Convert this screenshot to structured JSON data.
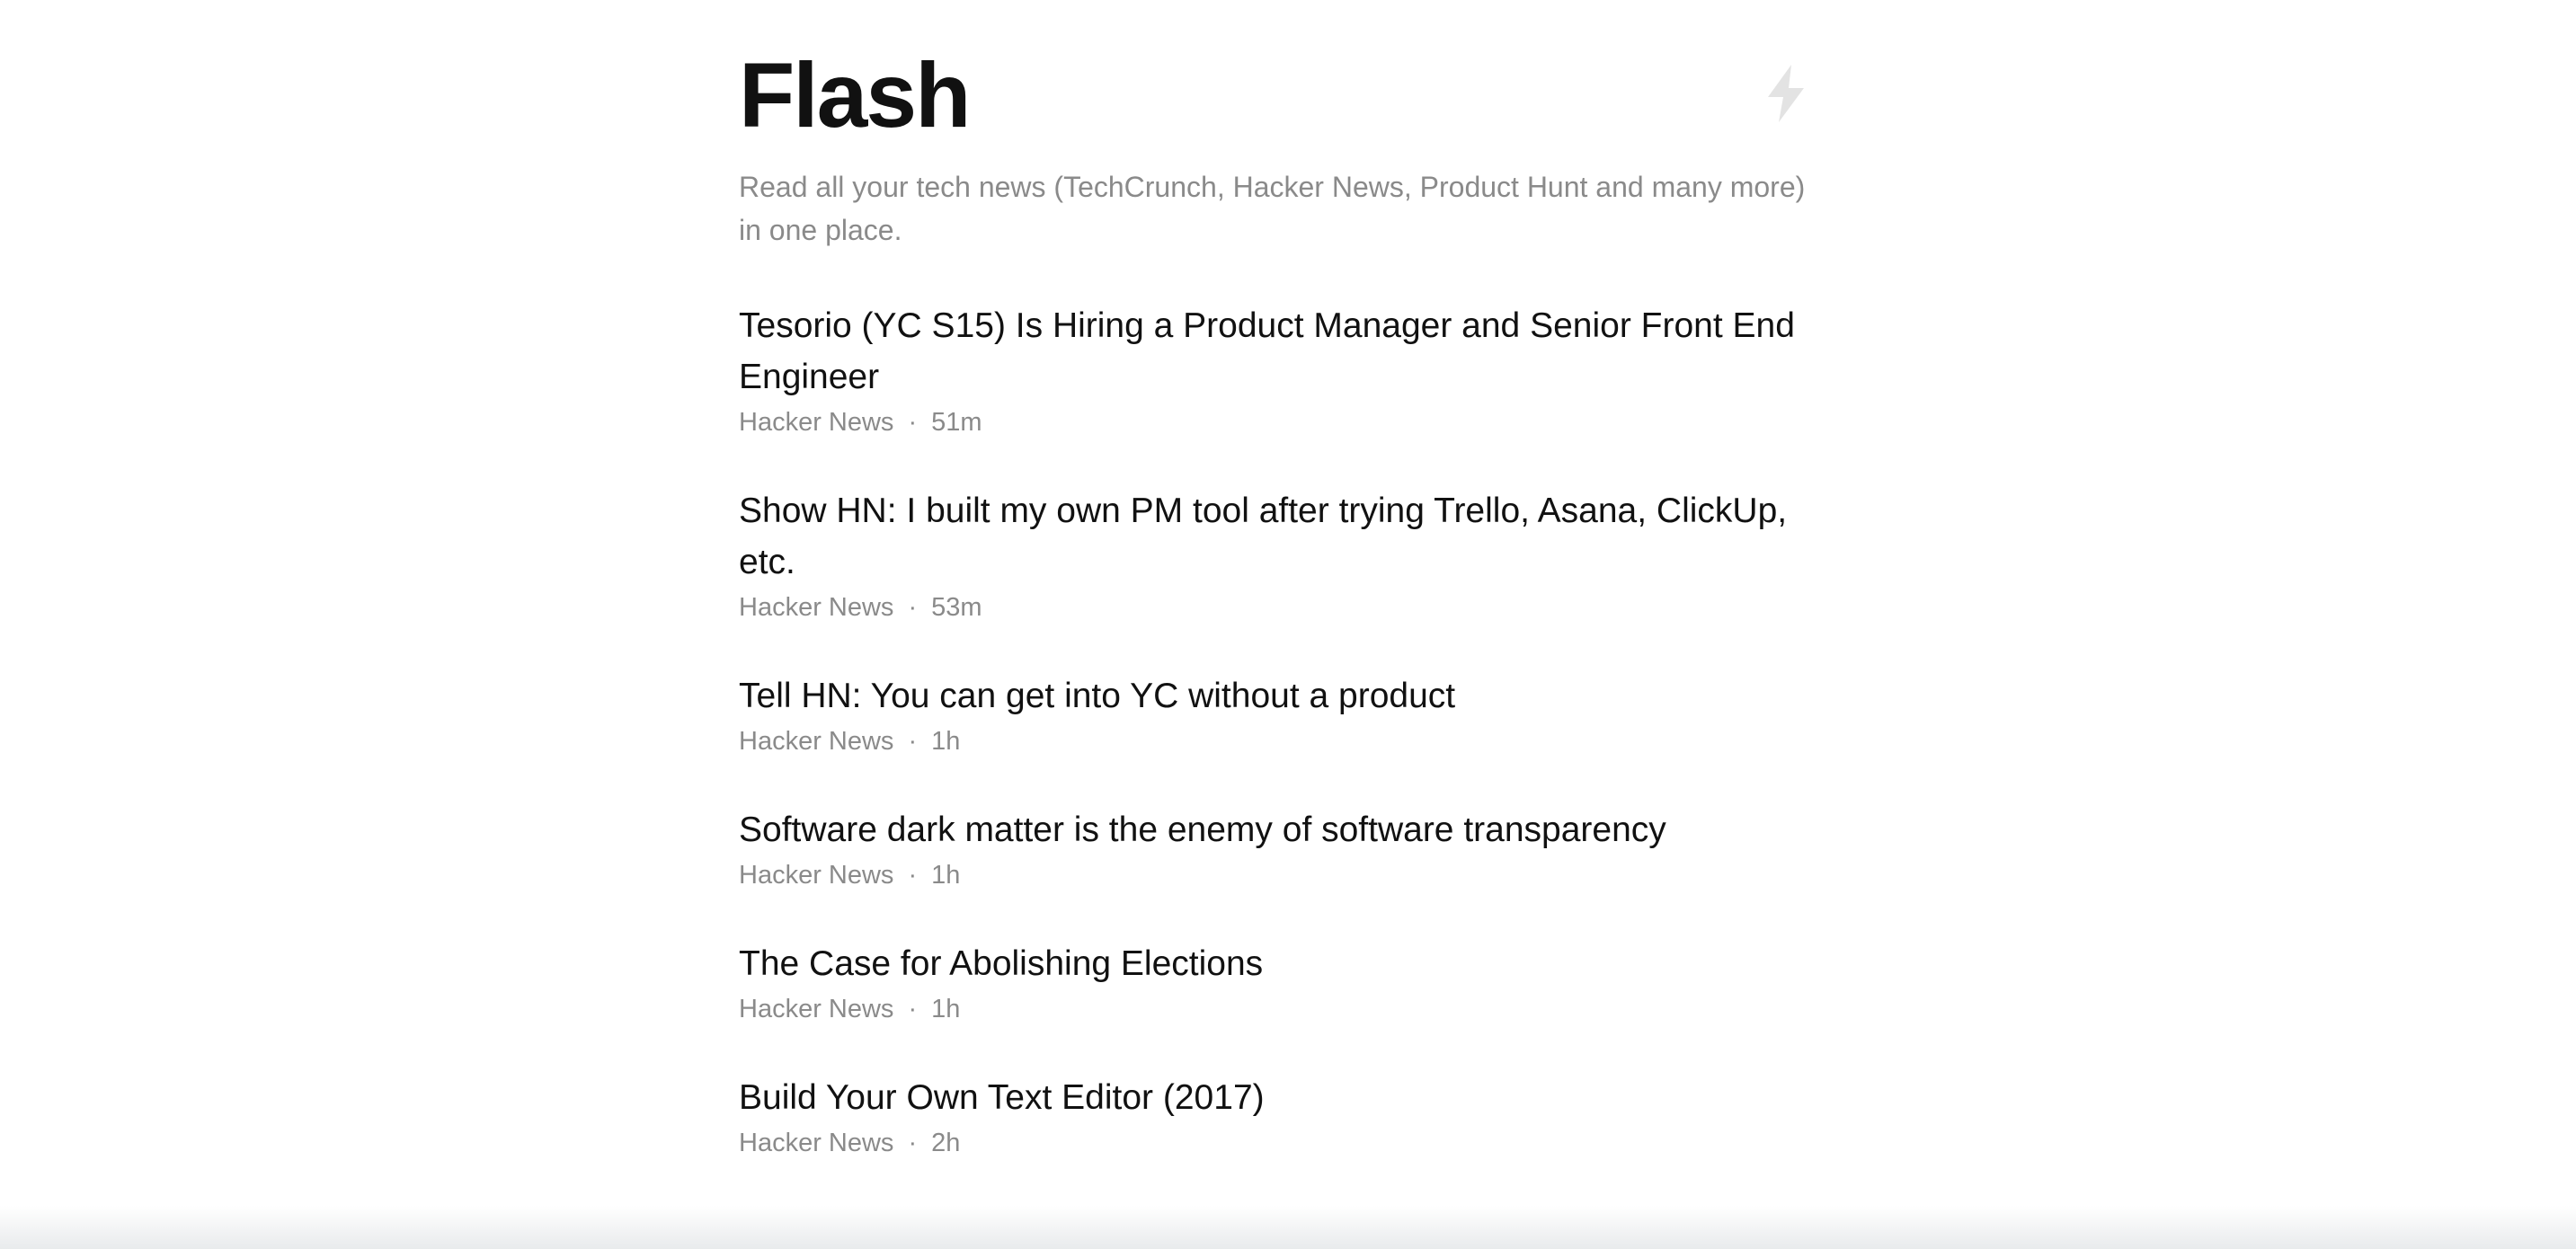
{
  "header": {
    "title": "Flash",
    "subtitle": "Read all your tech news (TechCrunch, Hacker News, Product Hunt and many more) in one place.",
    "icon": "lightning-icon"
  },
  "separator": "·",
  "items": [
    {
      "title": "Tesorio (YC S15) Is Hiring a Product Manager and Senior Front End Engineer",
      "source": "Hacker News",
      "time": "51m"
    },
    {
      "title": "Show HN: I built my own PM tool after trying Trello, Asana, ClickUp, etc.",
      "source": "Hacker News",
      "time": "53m"
    },
    {
      "title": "Tell HN: You can get into YC without a product",
      "source": "Hacker News",
      "time": "1h"
    },
    {
      "title": "Software dark matter is the enemy of software transparency",
      "source": "Hacker News",
      "time": "1h"
    },
    {
      "title": "The Case for Abolishing Elections",
      "source": "Hacker News",
      "time": "1h"
    },
    {
      "title": "Build Your Own Text Editor (2017)",
      "source": "Hacker News",
      "time": "2h"
    }
  ],
  "colors": {
    "text": "#111111",
    "muted": "#8a8a8a",
    "icon": "#e3e3e3"
  }
}
